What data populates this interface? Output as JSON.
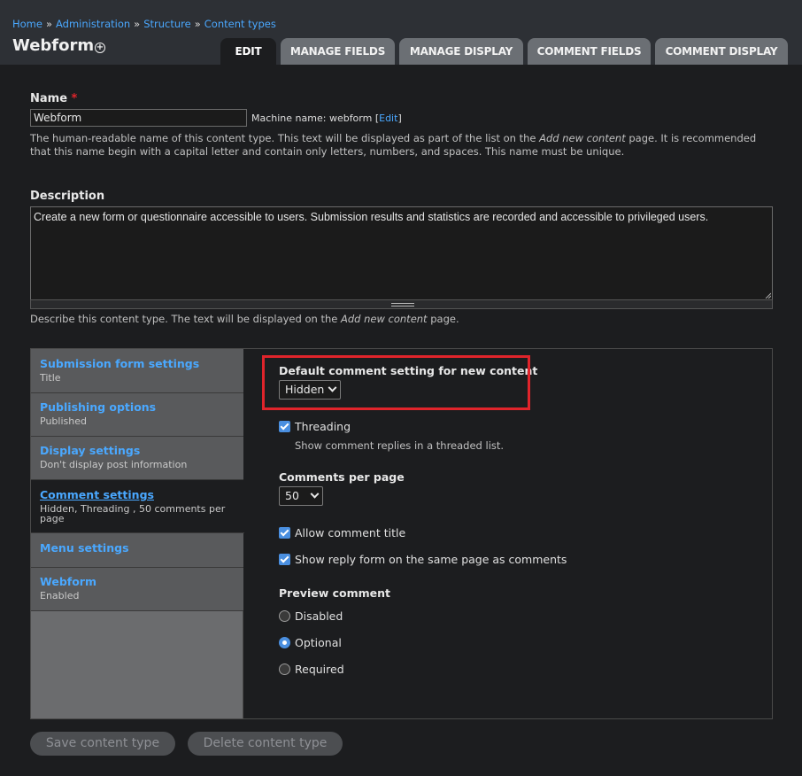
{
  "breadcrumb": [
    "Home",
    "Administration",
    "Structure",
    "Content types"
  ],
  "breadcrumb_sep": "»",
  "page": {
    "title": "Webform",
    "shortcut_icon": "plus-circle-icon"
  },
  "tabs": [
    "EDIT",
    "MANAGE FIELDS",
    "MANAGE DISPLAY",
    "COMMENT FIELDS",
    "COMMENT DISPLAY"
  ],
  "name_field": {
    "label": "Name",
    "required_mark": "*",
    "value": "Webform",
    "machine_prefix": "Machine name: webform [",
    "machine_edit": "Edit",
    "machine_suffix": "]",
    "help_1": "The human-readable name of this content type. This text will be displayed as part of the list on the ",
    "help_em": "Add new content",
    "help_2": " page. It is recommended that this name begin with a capital letter and contain only letters, numbers, and spaces. This name must be unique."
  },
  "description_field": {
    "label": "Description",
    "value": "Create a new form or questionnaire accessible to users. Submission results and statistics are recorded and accessible to privileged users.",
    "help_1": "Describe this content type. The text will be displayed on the ",
    "help_em": "Add new content",
    "help_2": " page."
  },
  "vertical_tabs": [
    {
      "title": "Submission form settings",
      "summary": "Title"
    },
    {
      "title": "Publishing options",
      "summary": "Published"
    },
    {
      "title": "Display settings",
      "summary": "Don't display post information"
    },
    {
      "title": "Comment settings",
      "summary": "Hidden, Threading , 50 comments per page"
    },
    {
      "title": "Menu settings",
      "summary": ""
    },
    {
      "title": "Webform",
      "summary": "Enabled"
    }
  ],
  "comment_pane": {
    "default_label": "Default comment setting for new content",
    "default_value": "Hidden",
    "threading_label": "Threading",
    "threading_desc": "Show comment replies in a threaded list.",
    "per_page_label": "Comments per page",
    "per_page_value": "50",
    "allow_title_label": "Allow comment title",
    "reply_form_label": "Show reply form on the same page as comments",
    "preview_label": "Preview comment",
    "preview_options": [
      "Disabled",
      "Optional",
      "Required"
    ],
    "preview_selected": "Optional"
  },
  "buttons": {
    "save": "Save content type",
    "delete": "Delete content type"
  },
  "colors": {
    "accent": "#4aa8ff",
    "highlight": "#e0242b",
    "checkbox": "#4a8fe0"
  }
}
